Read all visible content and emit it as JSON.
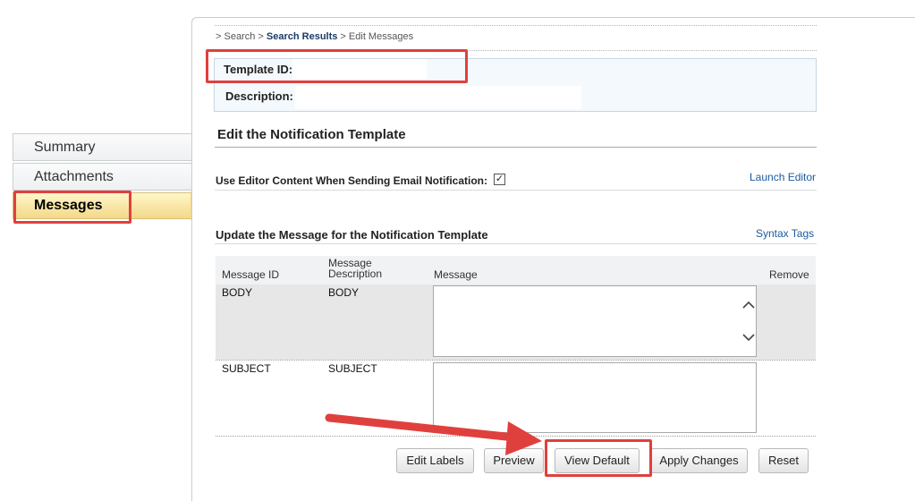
{
  "nav": {
    "items": [
      {
        "label": "Summary"
      },
      {
        "label": "Attachments"
      },
      {
        "label": "Messages",
        "active": true
      }
    ]
  },
  "breadcrumb": {
    "sep1": "> ",
    "item1": "Search",
    "sep2": " > ",
    "item2": "Search Results",
    "sep3": " > ",
    "item3": "Edit Messages"
  },
  "template": {
    "id_label": "Template ID:",
    "id_value": "",
    "description_label": "Description:",
    "description_value": ""
  },
  "edit_section": {
    "title": "Edit the Notification Template",
    "use_editor_label": "Use Editor Content When Sending Email Notification:",
    "use_editor_checked": true,
    "checkmark": "✓",
    "launch_editor": "Launch Editor"
  },
  "update_section": {
    "title": "Update the Message for the Notification Template",
    "syntax_tags": "Syntax Tags"
  },
  "table": {
    "headers": {
      "message_id": "Message ID",
      "message_description_line1": "Message",
      "message_description_line2": "Description",
      "message": "Message",
      "remove": "Remove"
    },
    "rows": [
      {
        "message_id": "BODY",
        "message_description": "BODY",
        "message": ""
      },
      {
        "message_id": "SUBJECT",
        "message_description": "SUBJECT",
        "message": ""
      }
    ]
  },
  "buttons": {
    "edit_labels": "Edit Labels",
    "preview": "Preview",
    "view_default": "View Default",
    "apply_changes": "Apply Changes",
    "reset": "Reset"
  },
  "icons": {
    "scroll_up": "chevron-up-icon",
    "scroll_down": "chevron-down-icon"
  },
  "colors": {
    "annotation_red": "#e0403d",
    "active_nav": "#f3d889",
    "link": "#1c5a9f"
  }
}
